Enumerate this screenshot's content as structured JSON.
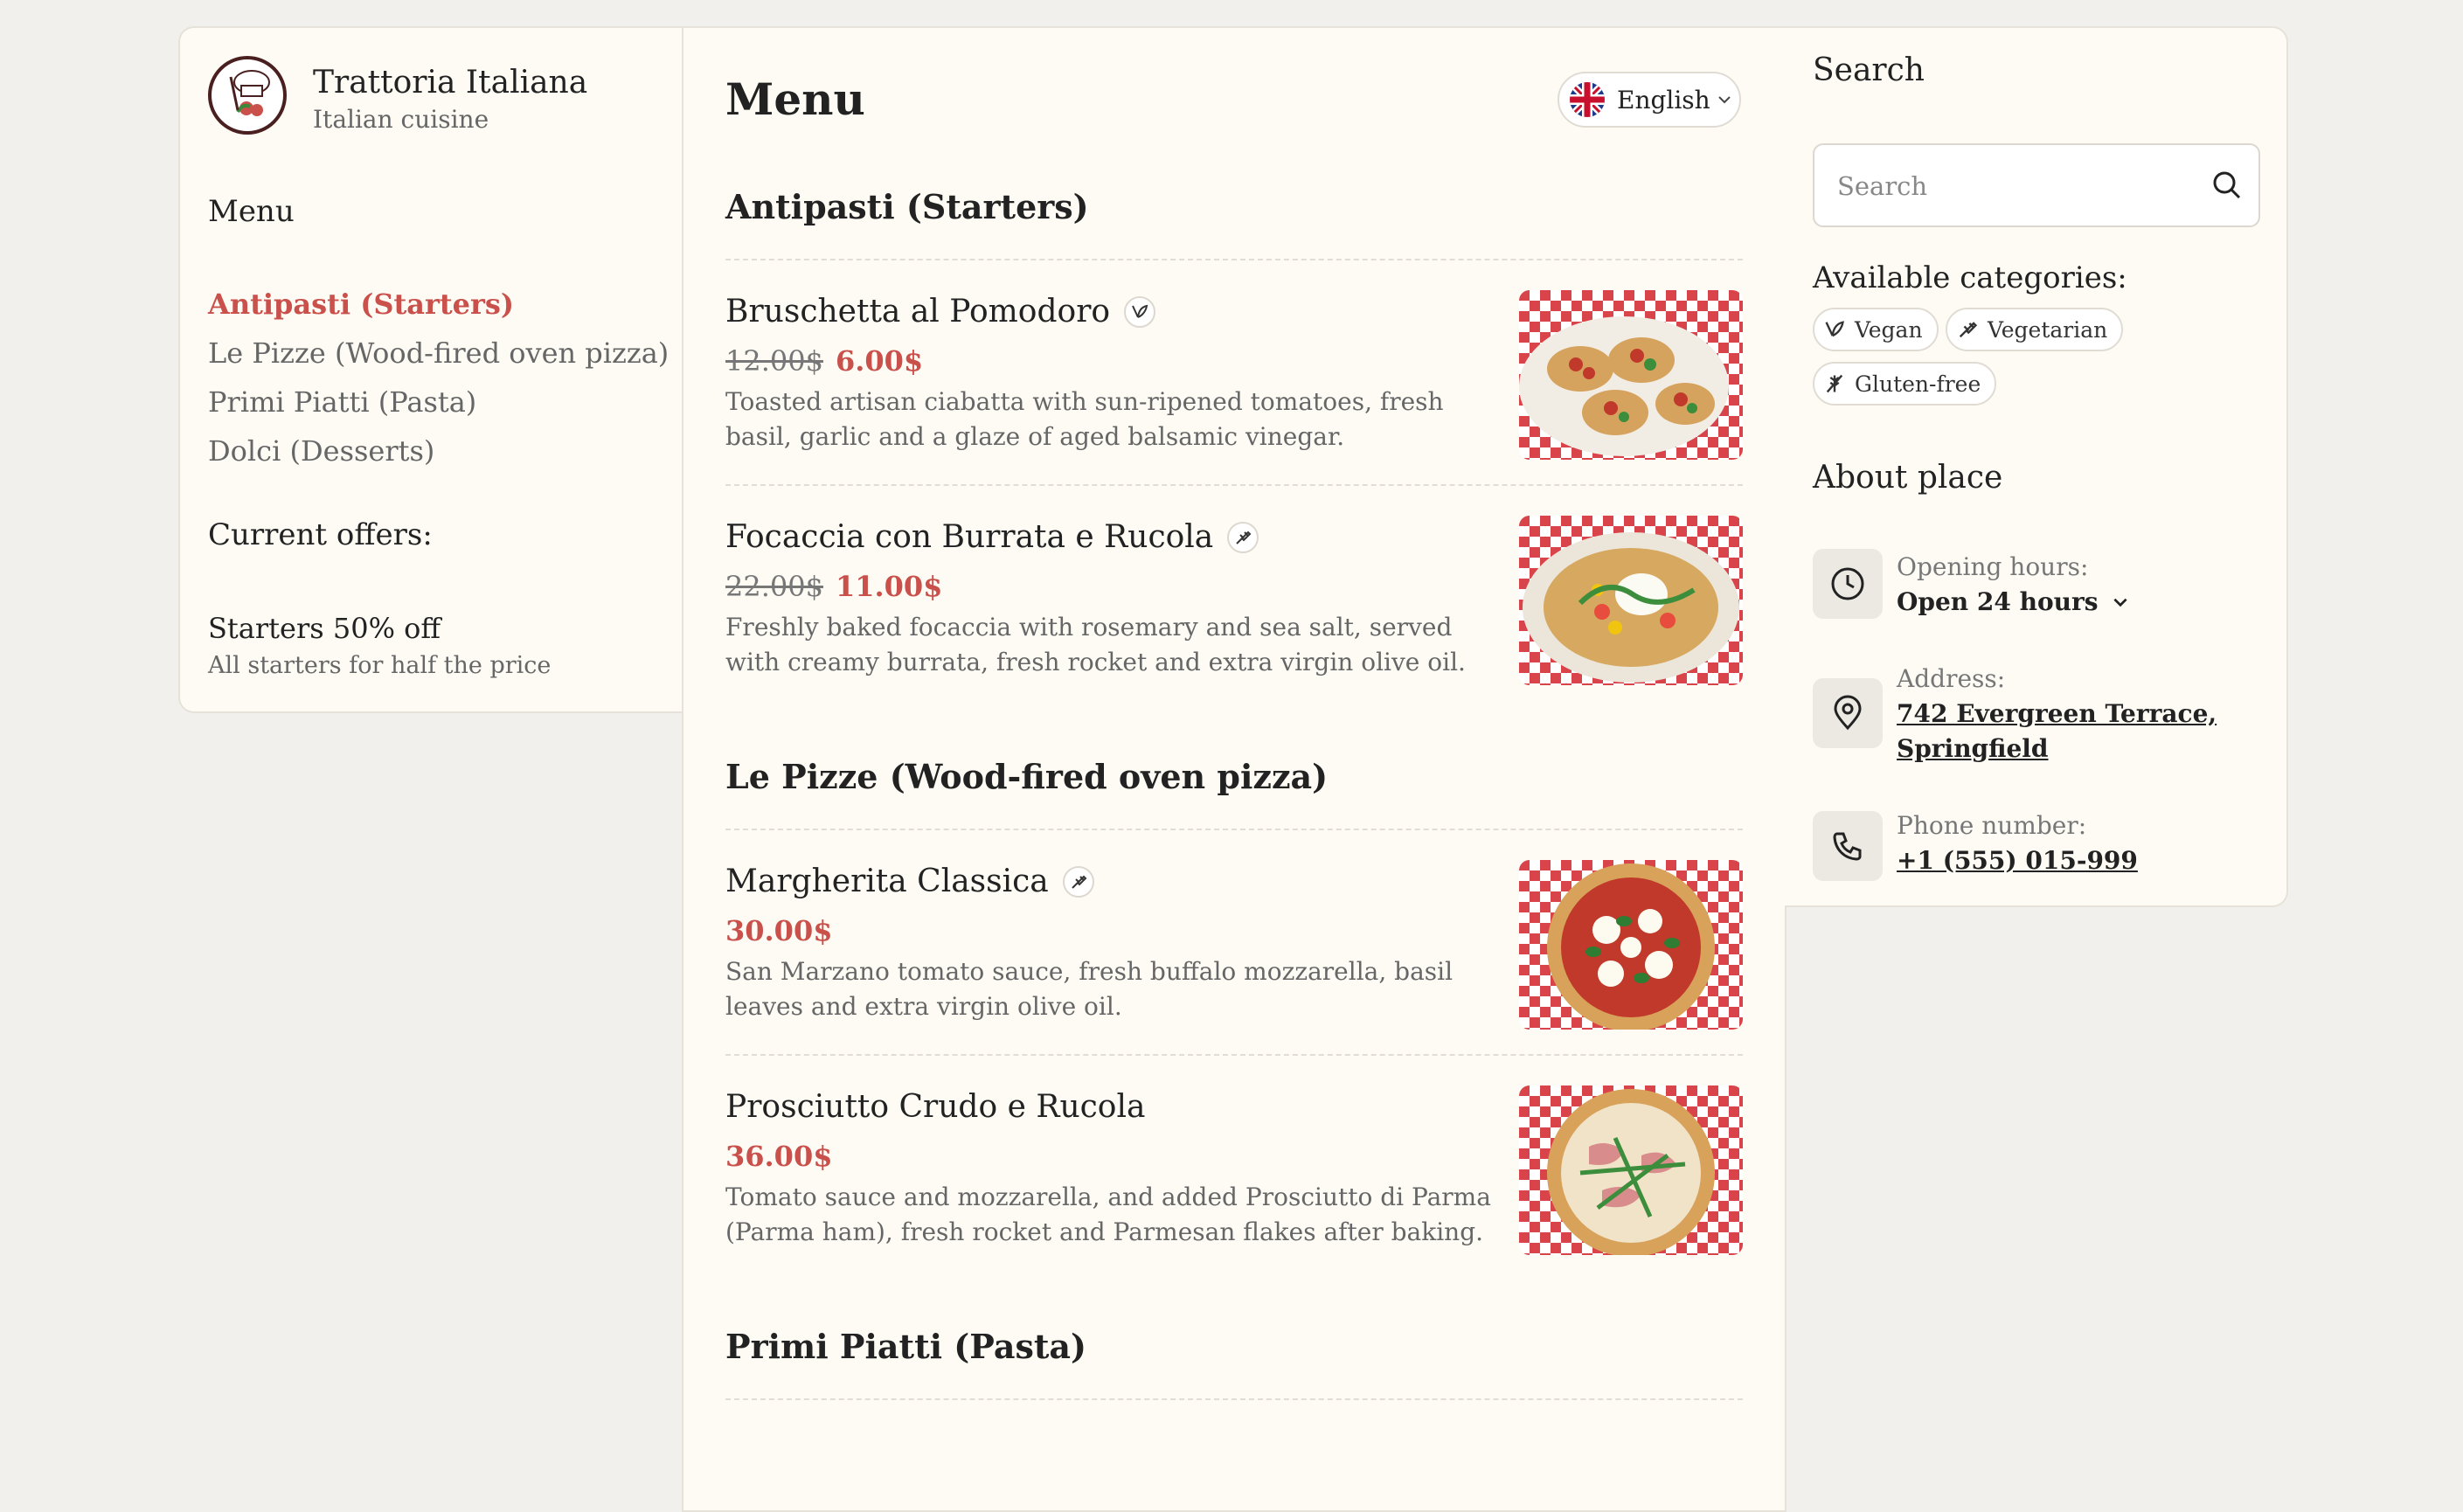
{
  "brand": {
    "name": "Trattoria Italiana",
    "subtitle": "Italian cuisine"
  },
  "sidebar": {
    "menu_heading": "Menu",
    "nav": [
      {
        "label": "Antipasti (Starters)",
        "active": true
      },
      {
        "label": "Le Pizze (Wood-fired oven pizza)",
        "active": false
      },
      {
        "label": "Primi Piatti (Pasta)",
        "active": false
      },
      {
        "label": "Dolci (Desserts)",
        "active": false
      }
    ],
    "offers_heading": "Current offers:",
    "offer": {
      "title": "Starters 50% off",
      "subtitle": "All starters for half the price"
    }
  },
  "main": {
    "title": "Menu",
    "language": {
      "label": "English",
      "flag": "uk-flag-icon"
    },
    "sections": [
      {
        "title": "Antipasti (Starters)",
        "items": [
          {
            "name": "Bruschetta al Pomodoro",
            "badge": "vegan-icon",
            "old_price": "12.00$",
            "price": "6.00$",
            "description": "Toasted artisan ciabatta with sun-ripened tomatoes, fresh basil, garlic and a glaze of aged balsamic vinegar."
          },
          {
            "name": "Focaccia con Burrata e Rucola",
            "badge": "vegetarian-icon",
            "old_price": "22.00$",
            "price": "11.00$",
            "description": "Freshly baked focaccia with rosemary and sea salt, served with creamy burrata, fresh rocket and extra virgin olive oil."
          }
        ]
      },
      {
        "title": "Le Pizze (Wood-fired oven pizza)",
        "items": [
          {
            "name": "Margherita Classica",
            "badge": "vegetarian-icon",
            "old_price": "",
            "price": "30.00$",
            "description": "San Marzano tomato sauce, fresh buffalo mozzarella, basil leaves and extra virgin olive oil."
          },
          {
            "name": "Prosciutto Crudo e Rucola",
            "badge": "",
            "old_price": "",
            "price": "36.00$",
            "description": "Tomato sauce and mozzarella, and added Prosciutto di Parma (Parma ham), fresh rocket and Parmesan flakes after baking."
          }
        ]
      },
      {
        "title": "Primi Piatti (Pasta)",
        "items": []
      }
    ]
  },
  "right": {
    "search_heading": "Search",
    "search_placeholder": "Search",
    "categories_heading": "Available categories:",
    "categories": [
      {
        "label": "Vegan",
        "icon": "vegan-icon"
      },
      {
        "label": "Vegetarian",
        "icon": "vegetarian-icon"
      },
      {
        "label": "Gluten-free",
        "icon": "gluten-free-icon"
      }
    ],
    "about_heading": "About place",
    "hours_label": "Opening hours:",
    "hours_value": "Open 24 hours",
    "address_label": "Address:",
    "address_line1": "742 Evergreen Terrace,",
    "address_line2": "Springfield",
    "phone_label": "Phone number:",
    "phone_value": "+1 (555) 015-999"
  },
  "colors": {
    "accent": "#c9504b",
    "background": "#f1f0ec",
    "panel": "#fdfbf4"
  }
}
